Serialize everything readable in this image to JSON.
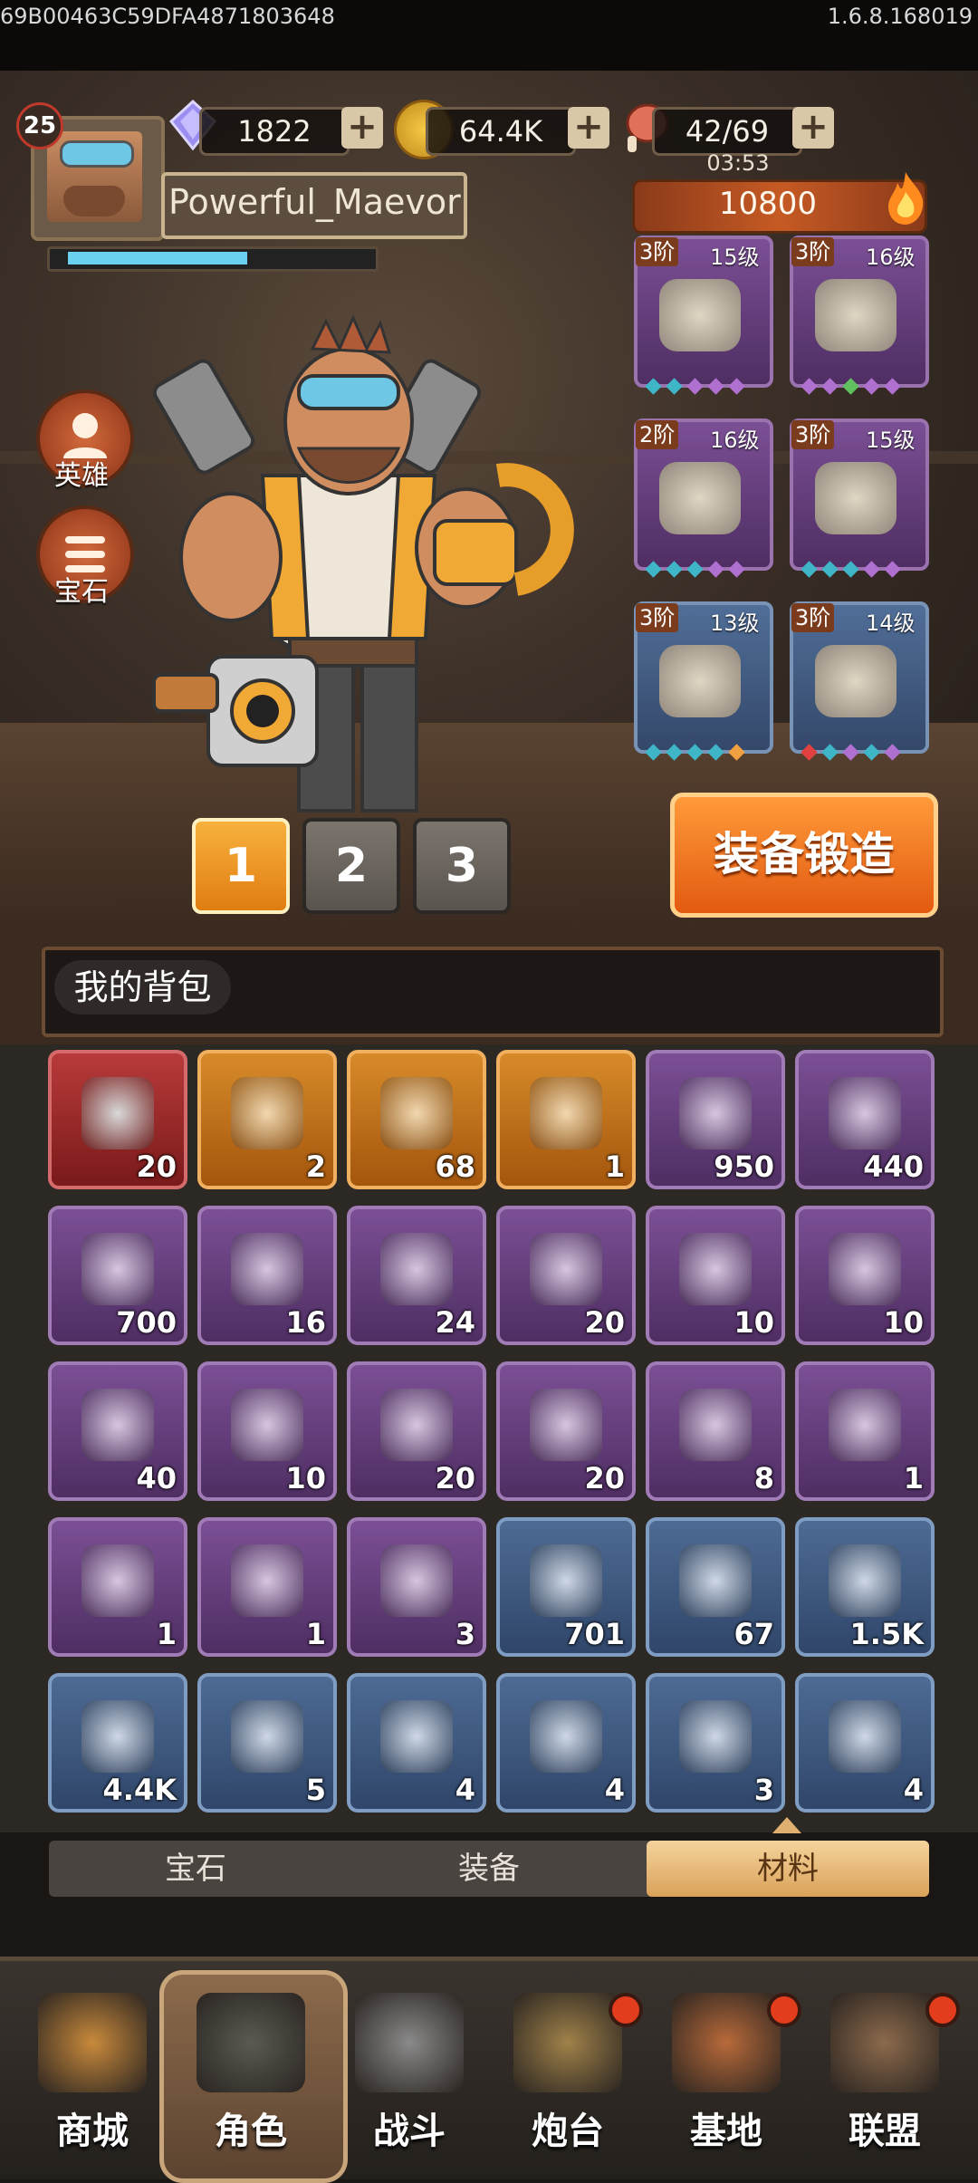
{
  "status_bar": {
    "device_id": "69B00463C59DFA4871803648",
    "version": "1.6.8.168019"
  },
  "player": {
    "level": "25",
    "name": "Powerful_Maevor",
    "xp_fraction": 0.55
  },
  "resources": {
    "gems": "1822",
    "coins": "64.4K",
    "stamina": "42/69",
    "stamina_timer": "03:53"
  },
  "power": "10800",
  "side_buttons": {
    "hero": "英雄",
    "gem": "宝石"
  },
  "equipment": [
    {
      "tier": "3阶",
      "level": "15级",
      "rarity": "purple",
      "icon": "helmet-icon",
      "dots": [
        "#3fb6c8",
        "#3fb6c8",
        "#b070d0",
        "#b070d0",
        "#b070d0"
      ]
    },
    {
      "tier": "3阶",
      "level": "16级",
      "rarity": "purple",
      "icon": "bracer-icon",
      "dots": [
        "#b070d0",
        "#b070d0",
        "#60c060",
        "#b070d0",
        "#b070d0"
      ]
    },
    {
      "tier": "2阶",
      "level": "16级",
      "rarity": "purple",
      "icon": "armor-icon",
      "dots": [
        "#3fb6c8",
        "#3fb6c8",
        "#3fb6c8",
        "#b070d0",
        "#b070d0"
      ]
    },
    {
      "tier": "3阶",
      "level": "15级",
      "rarity": "purple",
      "icon": "pants-icon",
      "dots": [
        "#3fb6c8",
        "#3fb6c8",
        "#3fb6c8",
        "#b070d0",
        "#b070d0"
      ]
    },
    {
      "tier": "3阶",
      "level": "13级",
      "rarity": "blue",
      "icon": "boots-icon",
      "dots": [
        "#3fb6c8",
        "#3fb6c8",
        "#3fb6c8",
        "#3fb6c8",
        "#f0a040"
      ]
    },
    {
      "tier": "3阶",
      "level": "14级",
      "rarity": "blue",
      "icon": "gloves-icon",
      "dots": [
        "#e04040",
        "#3fb6c8",
        "#b070d0",
        "#3fb6c8",
        "#b070d0"
      ]
    }
  ],
  "loadouts": [
    "1",
    "2",
    "3"
  ],
  "forge_button": "装备锻造",
  "bag_title": "我的背包",
  "inventory": [
    {
      "count": "20",
      "rarity": "red",
      "icon": "mech-blueprint-icon"
    },
    {
      "count": "2",
      "rarity": "orange",
      "icon": "canister-icon"
    },
    {
      "count": "68",
      "rarity": "orange",
      "icon": "scroll-icon"
    },
    {
      "count": "1",
      "rarity": "orange",
      "icon": "key-icon"
    },
    {
      "count": "950",
      "rarity": "purple",
      "icon": "chip-card-icon"
    },
    {
      "count": "440",
      "rarity": "purple",
      "icon": "pyramid-icon"
    },
    {
      "count": "700",
      "rarity": "purple",
      "icon": "fire-orb-icon"
    },
    {
      "count": "16",
      "rarity": "purple",
      "icon": "fist-ticket-icon"
    },
    {
      "count": "24",
      "rarity": "purple",
      "icon": "skill-card-icon"
    },
    {
      "count": "20",
      "rarity": "purple",
      "icon": "binocular-blueprint-icon"
    },
    {
      "count": "10",
      "rarity": "purple",
      "icon": "robot-blueprint-icon"
    },
    {
      "count": "10",
      "rarity": "purple",
      "icon": "rocket-blueprint-icon"
    },
    {
      "count": "40",
      "rarity": "purple",
      "icon": "tank-blueprint-icon"
    },
    {
      "count": "10",
      "rarity": "purple",
      "icon": "reactor-blueprint-icon"
    },
    {
      "count": "20",
      "rarity": "purple",
      "icon": "armor-blueprint-icon"
    },
    {
      "count": "20",
      "rarity": "purple",
      "icon": "turret-blueprint-icon"
    },
    {
      "count": "8",
      "rarity": "purple",
      "icon": "gear-icon"
    },
    {
      "count": "1",
      "rarity": "purple",
      "icon": "cube-icon"
    },
    {
      "count": "1",
      "rarity": "purple",
      "icon": "core-disc-icon"
    },
    {
      "count": "1",
      "rarity": "purple",
      "icon": "crystal-ore-icon"
    },
    {
      "count": "3",
      "rarity": "purple",
      "icon": "ticket-icon"
    },
    {
      "count": "701",
      "rarity": "blue",
      "icon": "badge-coin-icon"
    },
    {
      "count": "67",
      "rarity": "blue",
      "icon": "skull-gem-icon"
    },
    {
      "count": "1.5K",
      "rarity": "blue",
      "icon": "banner-icon"
    },
    {
      "count": "4.4K",
      "rarity": "blue",
      "icon": "crystal-shard-icon"
    },
    {
      "count": "5",
      "rarity": "blue",
      "icon": "bracer-gear-icon"
    },
    {
      "count": "4",
      "rarity": "blue",
      "icon": "vest-gear-icon"
    },
    {
      "count": "4",
      "rarity": "blue",
      "icon": "pants-gear-icon"
    },
    {
      "count": "3",
      "rarity": "blue",
      "icon": "boots-gear-icon"
    },
    {
      "count": "4",
      "rarity": "blue",
      "icon": "glove-gear-icon"
    }
  ],
  "categories": [
    "宝石",
    "装备",
    "材料"
  ],
  "active_category": 2,
  "nav": [
    {
      "label": "商城",
      "icon": "chest-icon",
      "badge": false
    },
    {
      "label": "角色",
      "icon": "hooded-character-icon",
      "badge": false,
      "active": true
    },
    {
      "label": "战斗",
      "icon": "crossed-cannons-icon",
      "badge": false
    },
    {
      "label": "炮台",
      "icon": "cannon-icon",
      "badge": true
    },
    {
      "label": "基地",
      "icon": "base-tower-icon",
      "badge": true
    },
    {
      "label": "联盟",
      "icon": "alliance-banner-icon",
      "badge": true
    }
  ],
  "colors": {
    "accent_orange": "#e07d11",
    "purple_rarity": "#7b4f95",
    "blue_rarity": "#4d6b94",
    "red_rarity": "#b83a3a",
    "orange_rarity": "#d88a2a",
    "xp_bar": "#6ad2f0"
  }
}
